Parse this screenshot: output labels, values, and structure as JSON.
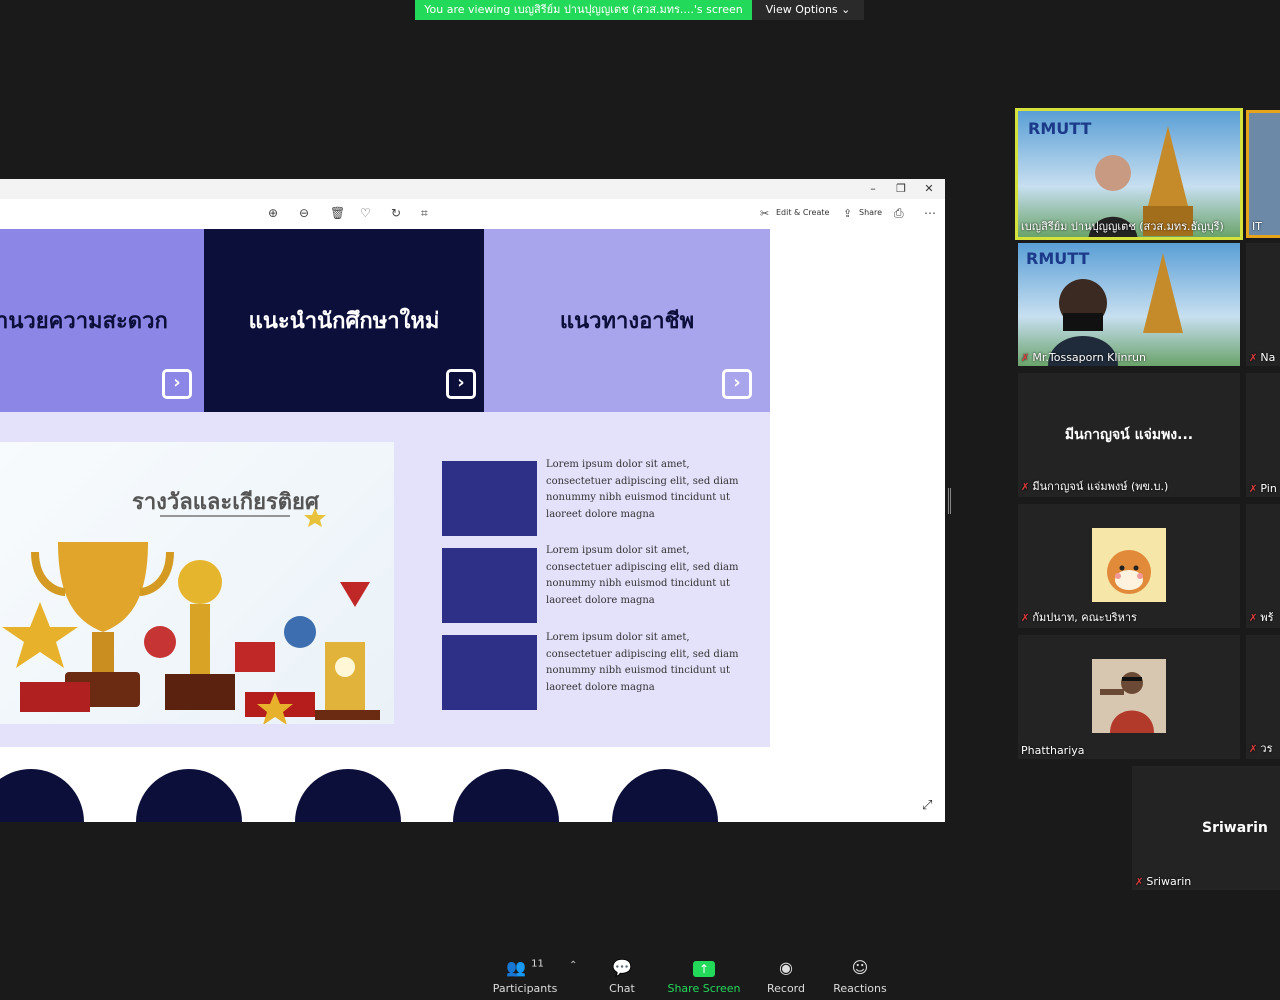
{
  "banner": {
    "prefix": "You are viewing ",
    "who": "เบญสิรีย์ม ปานปุญญเตช (สวส.มทร....'s screen",
    "viewopts": "View Options ⌄"
  },
  "toolbar": {
    "edit": "Edit & Create",
    "share": "Share"
  },
  "tiles": [
    {
      "label": "านวยความสะดวก"
    },
    {
      "label": "แนะนำนักศึกษาใหม่"
    },
    {
      "label": "แนวทางอาชีพ"
    }
  ],
  "award_title": "รางวัลและเกียรติยศ",
  "lorem": [
    "Lorem ipsum dolor sit amet, consectetuer adipiscing elit, sed diam nonummy nibh euismod tincidunt ut laoreet dolore magna",
    "Lorem ipsum dolor sit amet, consectetuer adipiscing elit, sed diam nonummy nibh euismod tincidunt ut laoreet dolore magna",
    "Lorem ipsum dolor sit amet, consectetuer adipiscing elit, sed diam nonummy nibh euismod tincidunt ut laoreet dolore magna"
  ],
  "participants_tiles": {
    "t1": "เบญสิรีย์ม ปานปุญญเตช (สวส.มทร.ธัญบุรี)",
    "t1b": "IT",
    "t2": "Mr.Tossaporn Klinrun",
    "t2b": "Na",
    "t3big": "มีนกาญจน์ แจ่มพง...",
    "t3": "มีนกาญจน์ แจ่มพงษ์ (พข.บ.)",
    "t3b": "Pin",
    "t4": "กัมปนาท, คณะบริหาร",
    "t4b": "พร้",
    "t5": "Phatthariya",
    "t5b": "วร",
    "t6big": "Sriwarin",
    "t6": "Sriwarin"
  },
  "bottom": {
    "participants": "Participants",
    "count": "11",
    "chat": "Chat",
    "share": "Share Screen",
    "record": "Record",
    "reactions": "Reactions"
  },
  "colors": {
    "share_green": "#23d959",
    "tile1": "#8c86e6",
    "tile2": "#0d0f3b",
    "tile3": "#a9a5ec",
    "square": "#2e2f86"
  }
}
